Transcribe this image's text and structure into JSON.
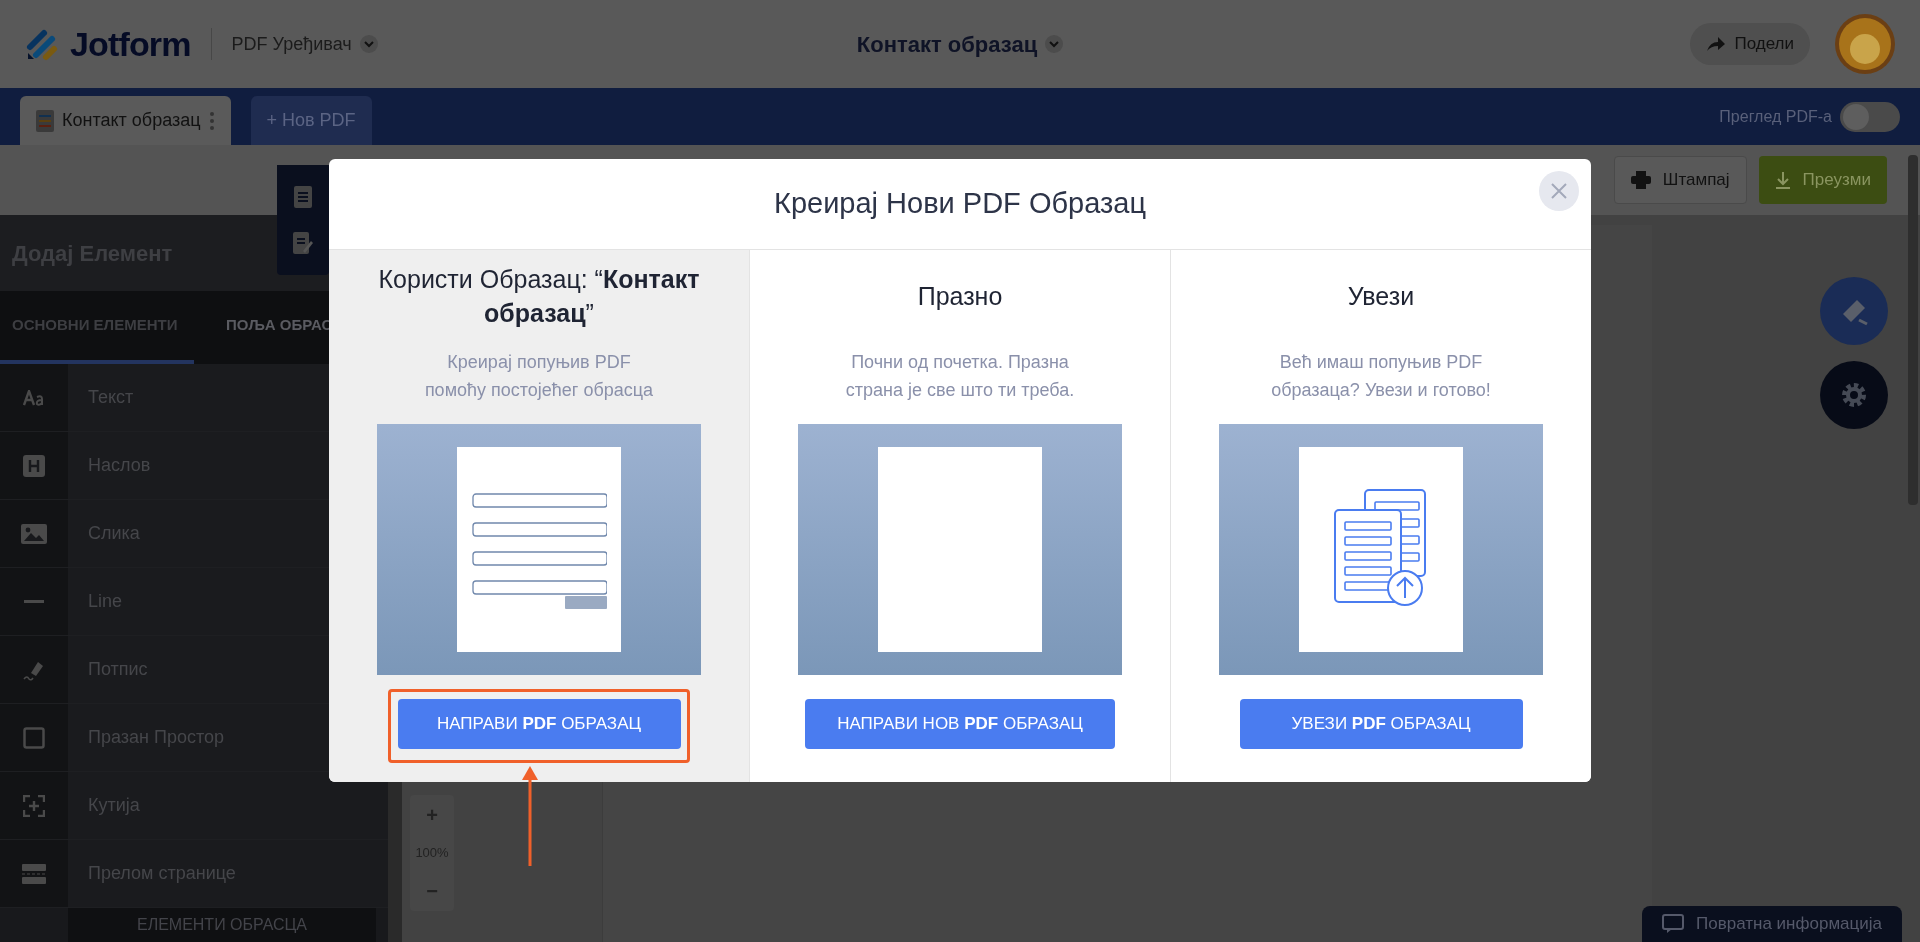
{
  "header": {
    "logo": "Jotform",
    "editor_menu": "PDF Уређивач",
    "document_title": "Контакт образац",
    "share_button": "Подели"
  },
  "tab_bar": {
    "tabs": [
      {
        "label": "Контакт образац",
        "selected": true
      }
    ],
    "new_pdf_button": "+ Нов PDF",
    "preview_toggle": {
      "label": "Преглед PDF-а",
      "on": false
    }
  },
  "toolbar": {
    "buttons": [
      {
        "label": "Штампај",
        "kind": "print"
      },
      {
        "label": "Преузми",
        "kind": "download"
      }
    ]
  },
  "sidebar": {
    "title": "Додај Елемент",
    "tabs": [
      {
        "label": "ОСНОВНИ ЕЛЕМЕНТИ",
        "selected": true
      },
      {
        "label": "ПОЉА ОБРАС",
        "selected": false
      }
    ],
    "items": [
      {
        "label": "Текст",
        "kind": "text"
      },
      {
        "label": "Наслов",
        "kind": "heading"
      },
      {
        "label": "Слика",
        "kind": "image"
      },
      {
        "label": "Line",
        "kind": "line"
      },
      {
        "label": "Потпис",
        "kind": "signature"
      },
      {
        "label": "Празан Простор",
        "kind": "spacer"
      },
      {
        "label": "Кутија",
        "kind": "box"
      },
      {
        "label": "Прелом странице",
        "kind": "pagebreak"
      }
    ],
    "section_footer": "ЕЛЕМЕНТИ ОБРАСЦА"
  },
  "zoom": {
    "zoom_in": "+",
    "level": "100%",
    "zoom_out": "−"
  },
  "feedback_button": "Повратна информација",
  "modal": {
    "title": "Креирај Нови PDF Образац",
    "options": [
      {
        "kind": "template",
        "selected": true,
        "heading": "Користи Образац: “**Контакт образац**”",
        "description": "Креирај попуњив PDF\nпомоћу постојећег обрасца",
        "button": "НАПРАВИ **PDF** ОБРАЗАЦ"
      },
      {
        "kind": "blank",
        "selected": false,
        "heading": "Празно",
        "description": "Почни од почетка. Празна\nстрана је све што ти треба.",
        "button": "НАПРАВИ НОВ **PDF** ОБРАЗАЦ"
      },
      {
        "kind": "import",
        "selected": false,
        "heading": "Увези",
        "description": "Већ имаш попуњив PDF\nобразаца? Увези и готово!",
        "button": "УВЕЗИ **PDF** ОБРАЗАЦ"
      }
    ]
  }
}
